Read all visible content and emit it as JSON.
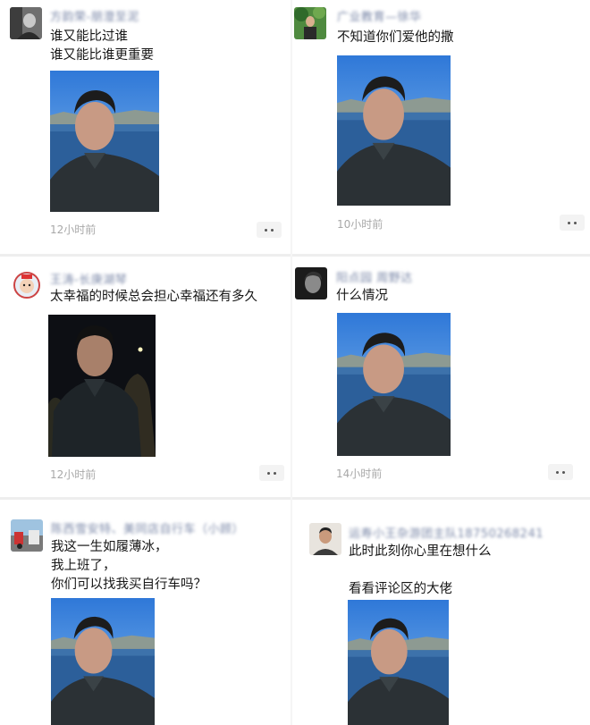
{
  "posts": [
    {
      "name": "方韵荣-朋澄至泥",
      "lines": [
        "谁又能比过谁",
        "谁又能比谁更重要"
      ],
      "time": "12小时前",
      "avatar_icon": "grayscale-portrait-avatar-icon",
      "photo": "man-lakeside-selfie"
    },
    {
      "name": "广业教育—徐华",
      "lines": [
        "不知道你们爱他的撒"
      ],
      "time": "10小时前",
      "avatar_icon": "green-outdoor-avatar-icon",
      "photo": "man-lakeside-selfie"
    },
    {
      "name": "王涛-长庚湖琴",
      "lines": [
        "太幸福的时候总会担心幸福还有多久"
      ],
      "time": "12小时前",
      "avatar_icon": "cartoon-astronaut-avatar-icon",
      "photo": "man-night-selfie"
    },
    {
      "name": "阳点园 周野达",
      "lines": [
        "什么情况"
      ],
      "time": "14小时前",
      "avatar_icon": "dark-face-avatar-icon",
      "photo": "man-lakeside-selfie"
    },
    {
      "name": "陈西雪安特、美同店自行车（小顾）",
      "lines": [
        "我这一生如履薄冰，",
        "我上班了，",
        "你们可以找我买自行车吗？"
      ],
      "time": "",
      "avatar_icon": "street-scene-avatar-icon",
      "photo": "man-lakeside-selfie"
    },
    {
      "name": "运寿小王杂游团主队18750268241",
      "lines": [
        "此时此刻你心里在想什么",
        "",
        "看看评论区的大佬"
      ],
      "time": "",
      "avatar_icon": "man-portrait-avatar-icon",
      "photo": "man-lakeside-selfie"
    }
  ]
}
